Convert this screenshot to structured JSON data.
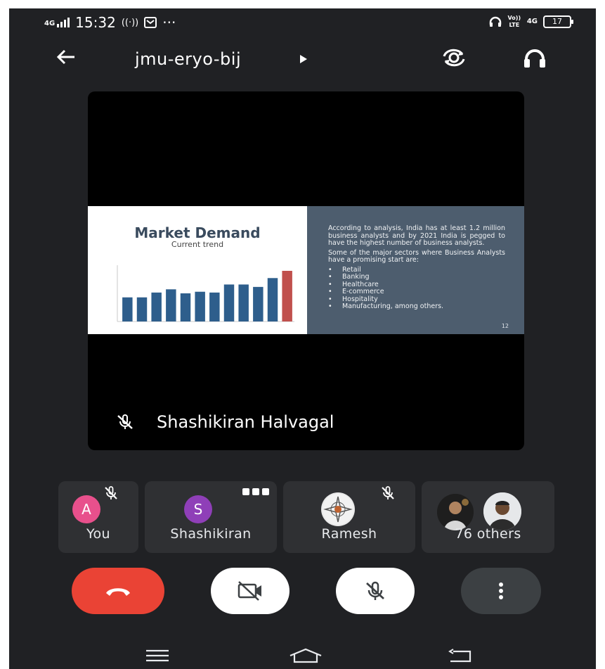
{
  "status_bar": {
    "network": "4G",
    "time": "15:32",
    "overflow_dots": "···",
    "network_right": "4G",
    "volte": "Vo)) LTE",
    "battery": "17"
  },
  "header": {
    "meeting_code": "jmu-eryo-bij"
  },
  "main_tile": {
    "presenter_name": "Shashikiran Halvagal",
    "slide": {
      "title": "Market Demand",
      "subtitle": "Current trend",
      "paragraph_1": "According to analysis, India has at least 1.2 million business analysts and by 2021 India is pegged to have the highest number of business analysts.",
      "paragraph_2": "Some of the major sectors where Business Analysts have a promising start are:",
      "bullets": [
        "Retail",
        "Banking",
        "Healthcare",
        "E-commerce",
        "Hospitality",
        "Manufacturing, among others."
      ],
      "page_number": "12"
    }
  },
  "chart_data": {
    "type": "bar",
    "values": [
      30,
      30,
      36,
      40,
      35,
      37,
      36,
      46,
      46,
      43,
      54,
      63
    ],
    "colors": [
      "#2e5e8c",
      "#2e5e8c",
      "#2e5e8c",
      "#2e5e8c",
      "#2e5e8c",
      "#2e5e8c",
      "#2e5e8c",
      "#2e5e8c",
      "#2e5e8c",
      "#2e5e8c",
      "#2e5e8c",
      "#c0504d"
    ]
  },
  "participants": [
    {
      "label": "You",
      "initial": "A",
      "muted": true
    },
    {
      "label": "Shashikiran",
      "initial": "S",
      "speaking": true
    },
    {
      "label": "Ramesh",
      "muted": true
    },
    {
      "label": "76 others"
    }
  ],
  "controls": {
    "end_call_color": "#ea4335",
    "camera": "off",
    "microphone": "off"
  }
}
